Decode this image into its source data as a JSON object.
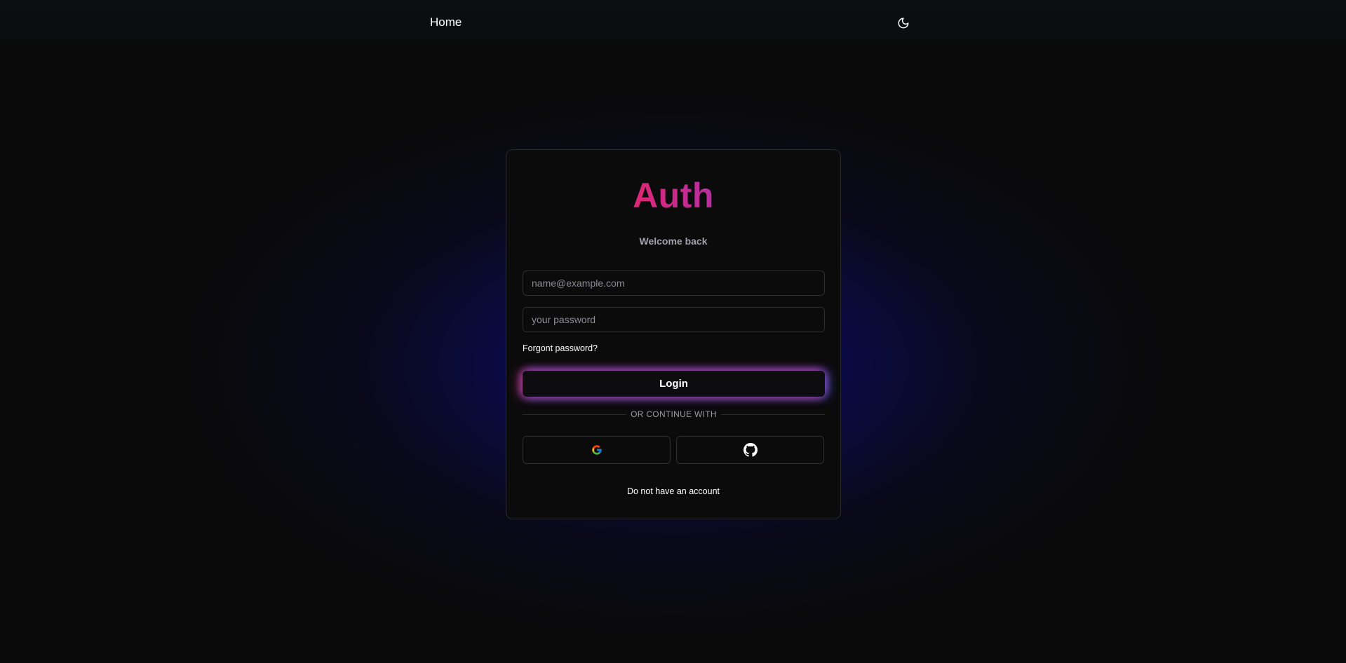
{
  "nav": {
    "home_label": "Home",
    "theme_icon": "moon-icon"
  },
  "auth": {
    "logo_text": "Auth",
    "subtitle": "Welcome back",
    "email_placeholder": "name@example.com",
    "password_placeholder": "your password",
    "forgot_label": "Forgont password?",
    "login_label": "Login",
    "divider_text": "OR CONTINUE WITH",
    "social": [
      {
        "icon": "google-icon"
      },
      {
        "icon": "github-icon"
      }
    ],
    "signup_label": "Do not have an account"
  },
  "colors": {
    "background": "#0a0a0b",
    "glow": "#0a0a6e",
    "logo_gradient": [
      "#c026d3",
      "#db2777",
      "#7c3aed"
    ],
    "card_border": "#2a2a2e"
  }
}
